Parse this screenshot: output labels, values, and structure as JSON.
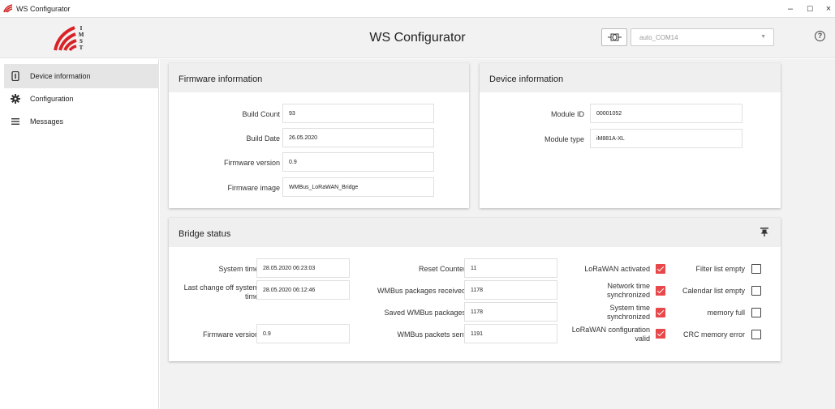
{
  "window": {
    "title": "WS Configurator",
    "minimize": "–",
    "maximize": "☐",
    "close": "×"
  },
  "header": {
    "app_title": "WS Configurator",
    "port_value": "auto_COM14",
    "port_caret": "▼",
    "help": "?"
  },
  "sidebar": {
    "items": [
      {
        "label": "Device information",
        "icon": "info-icon"
      },
      {
        "label": "Configuration",
        "icon": "gear-icon"
      },
      {
        "label": "Messages",
        "icon": "list-icon"
      }
    ]
  },
  "firmware": {
    "title": "Firmware information",
    "fields": [
      {
        "label": "Build Count",
        "value": "93"
      },
      {
        "label": "Build Date",
        "value": "26.05.2020"
      },
      {
        "label": "Firmware version",
        "value": "0.9"
      },
      {
        "label": "Firmware image",
        "value": "WMBus_LoRaWAN_Bridge"
      }
    ]
  },
  "device": {
    "title": "Device information",
    "fields": [
      {
        "label": "Module ID",
        "value": "00001052"
      },
      {
        "label": "Module type",
        "value": "iM881A-XL"
      }
    ]
  },
  "bridge": {
    "title": "Bridge status",
    "col1": [
      {
        "label": "System time",
        "value": "28.05.2020 06:23:03"
      },
      {
        "label_line1": "Last change off system",
        "label_line2": "time",
        "value": "28.05.2020 06:12:46"
      },
      {
        "label": "Firmware version",
        "value": "0.9"
      }
    ],
    "col2": [
      {
        "label": "Reset Counter",
        "value": "11"
      },
      {
        "label": "WMBus packages received",
        "value": "1178"
      },
      {
        "label": "Saved WMBus packages",
        "value": "1178"
      },
      {
        "label": "WMBus packets sent",
        "value": "1191"
      }
    ],
    "col3": [
      {
        "label": "LoRaWAN activated",
        "checked": true
      },
      {
        "label_line1": "Network time",
        "label_line2": "synchronized",
        "checked": true
      },
      {
        "label_line1": "System time",
        "label_line2": "synchronized",
        "checked": true
      },
      {
        "label_line1": "LoRaWAN configuration",
        "label_line2": "valid",
        "checked": true
      }
    ],
    "col4": [
      {
        "label": "Filter list empty",
        "checked": false
      },
      {
        "label": "Calendar list empty",
        "checked": false
      },
      {
        "label": "memory full",
        "checked": false
      },
      {
        "label": "CRC memory error",
        "checked": false
      }
    ]
  },
  "colors": {
    "accent_red": "#e8484a",
    "panel_header": "#efefef",
    "main_bg": "#f2f2f2",
    "sidebar_active": "#e5e5e5"
  }
}
